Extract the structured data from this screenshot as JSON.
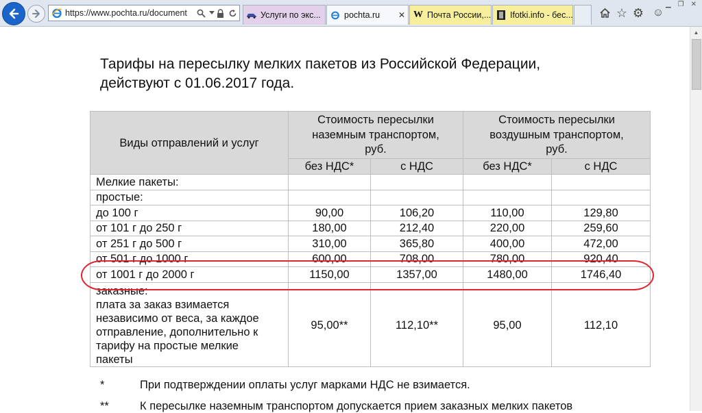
{
  "browser": {
    "url": "https://www.pochta.ru/document",
    "tabs": [
      {
        "label": "Услуги по экс...",
        "color": "#e3d0ea"
      },
      {
        "label": "pochta.ru",
        "color": "#f6f8fb"
      },
      {
        "label": "Почта России,...",
        "color": "#f7ef9b"
      },
      {
        "label": "Ifotki.info - бес...",
        "color": "#f7ef9b"
      }
    ],
    "accent": "#1b64c9"
  },
  "page": {
    "heading_line1": "Тарифы на пересылку мелких пакетов из Российской Федерации,",
    "heading_line2": "действуют с 01.06.2017 года.",
    "table": {
      "col_kind": "Виды отправлений и услуг",
      "ground_line1": "Стоимость пересылки",
      "ground_line2": "наземным транспортом,",
      "ground_line3": "руб.",
      "air_line1": "Стоимость пересылки",
      "air_line2": "воздушным транспортом,",
      "air_line3": "руб.",
      "no_vat": "без НДС*",
      "with_vat": "с НДС",
      "section_small_packets": "Мелкие пакеты:",
      "section_simple": "простые:",
      "rows": [
        {
          "label": "до 100 г",
          "g_no_vat": "90,00",
          "g_vat": "106,20",
          "a_no_vat": "110,00",
          "a_vat": "129,80"
        },
        {
          "label": "от 101 г до 250 г",
          "g_no_vat": "180,00",
          "g_vat": "212,40",
          "a_no_vat": "220,00",
          "a_vat": "259,60"
        },
        {
          "label": "от 251 г до 500 г",
          "g_no_vat": "310,00",
          "g_vat": "365,80",
          "a_no_vat": "400,00",
          "a_vat": "472,00"
        },
        {
          "label": "от 501 г до 1000 г",
          "g_no_vat": "600,00",
          "g_vat": "708,00",
          "a_no_vat": "780,00",
          "a_vat": "920,40"
        },
        {
          "label": "от 1001 г до 2000 г",
          "g_no_vat": "1150,00",
          "g_vat": "1357,00",
          "a_no_vat": "1480,00",
          "a_vat": "1746,40"
        }
      ],
      "registered": {
        "line1": "заказные:",
        "line2": "плата за заказ взимается",
        "line3": "независимо от веса, за каждое",
        "line4": "отправление, дополнительно к",
        "line5": "тарифу на простые мелкие",
        "line6": "пакеты",
        "g_no_vat": "95,00**",
        "g_vat": "112,10**",
        "a_no_vat": "95,00",
        "a_vat": "112,10"
      }
    },
    "notes": [
      {
        "mark": "*",
        "text": "При подтверждении оплаты услуг марками НДС не взимается."
      },
      {
        "mark": "**",
        "text": "К пересылке наземным транспортом допускается прием заказных мелких пакетов"
      }
    ],
    "highlight_color": "#e0252f"
  }
}
